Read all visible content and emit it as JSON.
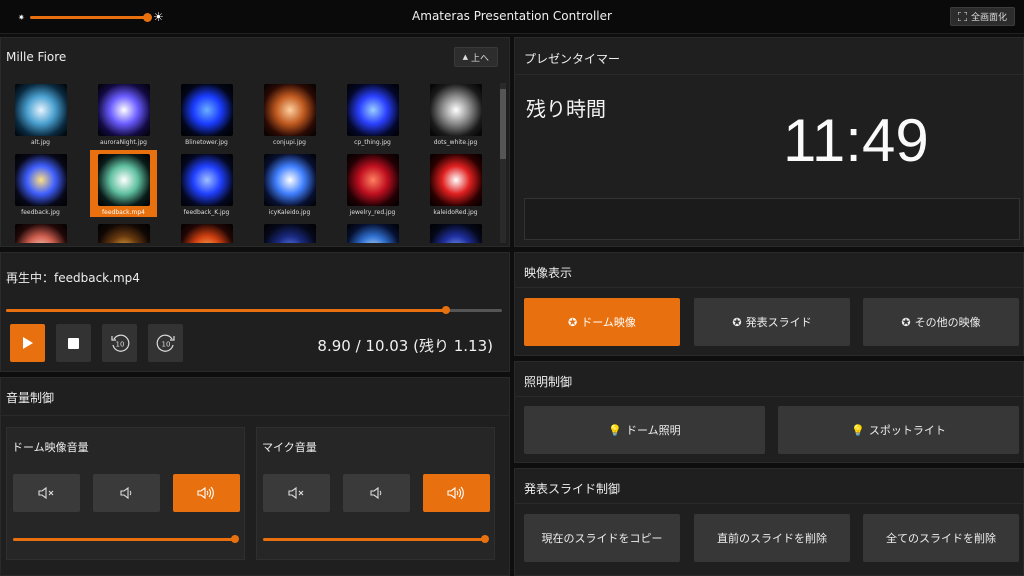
{
  "app": {
    "title": "Amateras Presentation Controller",
    "fullscreen_label": "全画面化",
    "brightness": 0.88
  },
  "gallery": {
    "title": "Mille Fiore",
    "up_label": "上へ",
    "items": [
      {
        "label": "alt.jpg",
        "colors": [
          "#e8f4ff",
          "#4aa0d0",
          "#0a2a40"
        ]
      },
      {
        "label": "auroraNight.jpg",
        "colors": [
          "#ffffff",
          "#6a5cff",
          "#120a40"
        ]
      },
      {
        "label": "Blinetower.jpg",
        "colors": [
          "#6ab0ff",
          "#1a3cff",
          "#020618"
        ]
      },
      {
        "label": "conjupi.jpg",
        "colors": [
          "#ffd0a0",
          "#c05a20",
          "#2a0a04"
        ]
      },
      {
        "label": "cp_thing.jpg",
        "colors": [
          "#9ad0ff",
          "#2a40ff",
          "#04082a"
        ]
      },
      {
        "label": "dots_white.jpg",
        "colors": [
          "#ffffff",
          "#8a8a8a",
          "#1a1a1a"
        ]
      },
      {
        "label": "feedback.jpg",
        "colors": [
          "#ffe080",
          "#4060ff",
          "#080818"
        ]
      },
      {
        "label": "feedback.mp4",
        "colors": [
          "#ffffff",
          "#60c0a0",
          "#0a1a18"
        ]
      },
      {
        "label": "feedback_K.jpg",
        "colors": [
          "#a0c0ff",
          "#2040ff",
          "#040820"
        ]
      },
      {
        "label": "icyKaleido.jpg",
        "colors": [
          "#ffffff",
          "#4080ff",
          "#081030"
        ]
      },
      {
        "label": "jewelry_red.jpg",
        "colors": [
          "#ff8060",
          "#c01020",
          "#200004"
        ]
      },
      {
        "label": "kaleidoRed.jpg",
        "colors": [
          "#ffffff",
          "#e02020",
          "#2a0000"
        ]
      },
      {
        "label": "",
        "colors": [
          "#ffd0c0",
          "#d06050",
          "#200808"
        ]
      },
      {
        "label": "",
        "colors": [
          "#f0b040",
          "#6a3a10",
          "#100804"
        ]
      },
      {
        "label": "",
        "colors": [
          "#ffb060",
          "#d04010",
          "#200604"
        ]
      },
      {
        "label": "",
        "colors": [
          "#6080ff",
          "#1a2a80",
          "#050818"
        ]
      },
      {
        "label": "",
        "colors": [
          "#c0e0ff",
          "#3070d0",
          "#061030"
        ]
      },
      {
        "label": "",
        "colors": [
          "#80a0ff",
          "#2030a0",
          "#040818"
        ]
      }
    ],
    "selected_index": 7
  },
  "timer": {
    "title": "プレゼンタイマー",
    "remaining_label": "残り時間",
    "remaining_time": "11:49"
  },
  "player": {
    "now_playing": "再生中：feedback.mp4",
    "progress": 0.887,
    "time_readout": "8.90 / 10.03 (残り 1.13)"
  },
  "video_display": {
    "title": "映像表示",
    "buttons": [
      {
        "label": "ドーム映像",
        "active": true
      },
      {
        "label": "発表スライド",
        "active": false
      },
      {
        "label": "その他の映像",
        "active": false
      }
    ]
  },
  "lighting": {
    "title": "照明制御",
    "buttons": [
      {
        "label": "ドーム照明"
      },
      {
        "label": "スポットライト"
      }
    ]
  },
  "slides": {
    "title": "発表スライド制御",
    "buttons": [
      {
        "label": "現在のスライドをコピー"
      },
      {
        "label": "直前のスライドを削除"
      },
      {
        "label": "全てのスライドを削除"
      }
    ]
  },
  "volume": {
    "title": "音量制御",
    "groups": [
      {
        "title": "ドーム映像音量",
        "level": 1.0,
        "active_index": 2
      },
      {
        "title": "マイク音量",
        "level": 1.0,
        "active_index": 2
      }
    ]
  },
  "colors": {
    "accent": "#e8700e",
    "panel": "#1f1f1f",
    "button": "#373737"
  }
}
